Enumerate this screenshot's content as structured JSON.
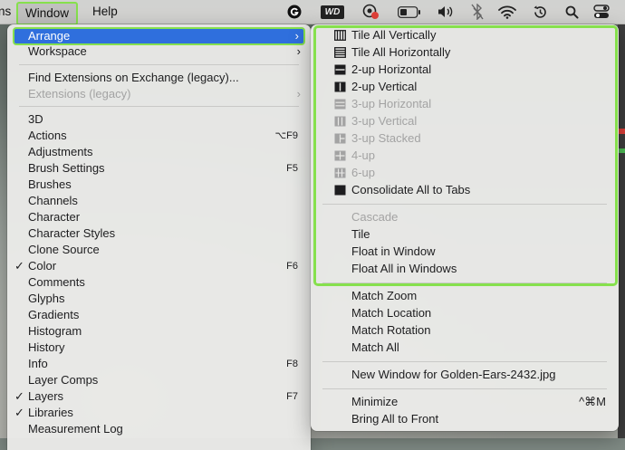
{
  "menubar": {
    "fragment": "ns",
    "window_label": "Window",
    "help_label": "Help",
    "wd_label": "WD",
    "status_icons": [
      "grammarly-icon",
      "wd-drive-icon",
      "recording-icon",
      "battery-icon",
      "volume-icon",
      "bluetooth-off-icon",
      "wifi-icon",
      "time-machine-icon",
      "search-icon",
      "control-center-icon"
    ]
  },
  "window_menu": {
    "arrange": "Arrange",
    "workspace": "Workspace",
    "find_extensions": "Find Extensions on Exchange (legacy)...",
    "extensions": "Extensions (legacy)",
    "items": [
      {
        "label": "3D",
        "shortcut": "",
        "checked": false
      },
      {
        "label": "Actions",
        "shortcut": "⌥F9",
        "checked": false
      },
      {
        "label": "Adjustments",
        "shortcut": "",
        "checked": false
      },
      {
        "label": "Brush Settings",
        "shortcut": "F5",
        "checked": false
      },
      {
        "label": "Brushes",
        "shortcut": "",
        "checked": false
      },
      {
        "label": "Channels",
        "shortcut": "",
        "checked": false
      },
      {
        "label": "Character",
        "shortcut": "",
        "checked": false
      },
      {
        "label": "Character Styles",
        "shortcut": "",
        "checked": false
      },
      {
        "label": "Clone Source",
        "shortcut": "",
        "checked": false
      },
      {
        "label": "Color",
        "shortcut": "F6",
        "checked": true
      },
      {
        "label": "Comments",
        "shortcut": "",
        "checked": false
      },
      {
        "label": "Glyphs",
        "shortcut": "",
        "checked": false
      },
      {
        "label": "Gradients",
        "shortcut": "",
        "checked": false
      },
      {
        "label": "Histogram",
        "shortcut": "",
        "checked": false
      },
      {
        "label": "History",
        "shortcut": "",
        "checked": false
      },
      {
        "label": "Info",
        "shortcut": "F8",
        "checked": false
      },
      {
        "label": "Layer Comps",
        "shortcut": "",
        "checked": false
      },
      {
        "label": "Layers",
        "shortcut": "F7",
        "checked": true
      },
      {
        "label": "Libraries",
        "shortcut": "",
        "checked": true
      },
      {
        "label": "Measurement Log",
        "shortcut": "",
        "checked": false
      }
    ],
    "check_glyph": "✓",
    "arrow_glyph": "›"
  },
  "arrange_menu": {
    "layouts": [
      {
        "label": "Tile All Vertically",
        "icon": "tile-vertical-icon",
        "disabled": false
      },
      {
        "label": "Tile All Horizontally",
        "icon": "tile-horizontal-icon",
        "disabled": false
      },
      {
        "label": "2-up Horizontal",
        "icon": "two-up-horizontal-icon",
        "disabled": false
      },
      {
        "label": "2-up Vertical",
        "icon": "two-up-vertical-icon",
        "disabled": false
      },
      {
        "label": "3-up Horizontal",
        "icon": "three-up-horizontal-icon",
        "disabled": true
      },
      {
        "label": "3-up Vertical",
        "icon": "three-up-vertical-icon",
        "disabled": true
      },
      {
        "label": "3-up Stacked",
        "icon": "three-up-stacked-icon",
        "disabled": true
      },
      {
        "label": "4-up",
        "icon": "four-up-icon",
        "disabled": true
      },
      {
        "label": "6-up",
        "icon": "six-up-icon",
        "disabled": true
      },
      {
        "label": "Consolidate All to Tabs",
        "icon": "consolidate-tabs-icon",
        "disabled": false
      }
    ],
    "cascade": "Cascade",
    "tile": "Tile",
    "float_in_window": "Float in Window",
    "float_all": "Float All in Windows",
    "match_zoom": "Match Zoom",
    "match_location": "Match Location",
    "match_rotation": "Match Rotation",
    "match_all": "Match All",
    "new_window": "New Window for Golden-Ears-2432.jpg",
    "minimize": "Minimize",
    "minimize_shortcut": "^⌘M",
    "bring_all_front": "Bring All to Front"
  },
  "colors": {
    "highlight": "#2f6fdd",
    "annotation_green": "#86e04d",
    "disabled_text": "#a3a3a3"
  }
}
